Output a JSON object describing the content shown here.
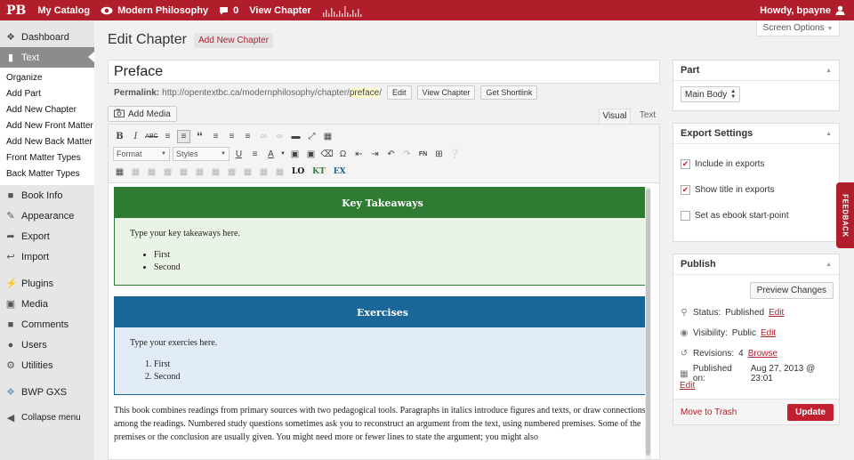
{
  "topbar": {
    "logo": "PB",
    "catalog": "My Catalog",
    "book": "Modern Philosophy",
    "comments": "0",
    "view": "View Chapter",
    "howdy": "Howdy, bpayne"
  },
  "sidebar": {
    "dashboard": "Dashboard",
    "text": "Text",
    "submenu": [
      "Organize",
      "Add Part",
      "Add New Chapter",
      "Add New Front Matter",
      "Add New Back Matter",
      "Front Matter Types",
      "Back Matter Types"
    ],
    "book_info": "Book Info",
    "appearance": "Appearance",
    "export": "Export",
    "import": "Import",
    "plugins": "Plugins",
    "media": "Media",
    "comments": "Comments",
    "users": "Users",
    "utilities": "Utilities",
    "bwp": "BWP GXS",
    "collapse": "Collapse menu"
  },
  "page": {
    "title": "Edit Chapter",
    "add_new": "Add New Chapter",
    "screen_options": "Screen Options"
  },
  "post": {
    "title": "Preface",
    "permalink_label": "Permalink:",
    "permalink_base": "http://opentextbc.ca/modernphilosophy/chapter/",
    "permalink_slug": "preface",
    "permalink_end": "/",
    "edit": "Edit",
    "view_chapter": "View Chapter",
    "shortlink": "Get Shortlink"
  },
  "editor": {
    "add_media": "Add Media",
    "tab_visual": "Visual",
    "tab_text": "Text",
    "format": "Format",
    "styles": "Styles",
    "lo": "LO",
    "kt": "KT",
    "ex": "EX",
    "takeaways": {
      "title": "Key Takeaways",
      "prompt": "Type your key takeaways here.",
      "items": [
        "First",
        "Second"
      ]
    },
    "exercises": {
      "title": "Exercises",
      "prompt": "Type your exercies here.",
      "items": [
        "First",
        "Second"
      ]
    },
    "intro": "This book combines readings from primary sources with two pedagogical tools. Paragraphs in italics introduce figures and texts, or draw connections among the readings. Numbered study questions sometimes ask you to reconstruct an argument from the text, using numbered premises. Some of the premises or the conclusion are usually given. You might need more or fewer lines to state the argument; you might also"
  },
  "part": {
    "title": "Part",
    "value": "Main Body"
  },
  "export_settings": {
    "title": "Export Settings",
    "include": "Include in exports",
    "show_title": "Show title in exports",
    "start_point": "Set as ebook start-point"
  },
  "publish": {
    "title": "Publish",
    "preview": "Preview Changes",
    "status_label": "Status:",
    "status": "Published",
    "visibility_label": "Visibility:",
    "visibility": "Public",
    "revisions_label": "Revisions:",
    "revisions": "4",
    "browse": "Browse",
    "published_label": "Published on:",
    "published": "Aug 27, 2013 @ 23:01",
    "edit": "Edit",
    "trash": "Move to Trash",
    "update": "Update"
  },
  "feedback": "FEEDBACK",
  "colors": {
    "brand": "#b01e2c",
    "takeaways": "#2f7b33",
    "takeaways_bg": "#e9f4e7",
    "exercises": "#1a6698",
    "exercises_bg": "#e1ecf6"
  }
}
